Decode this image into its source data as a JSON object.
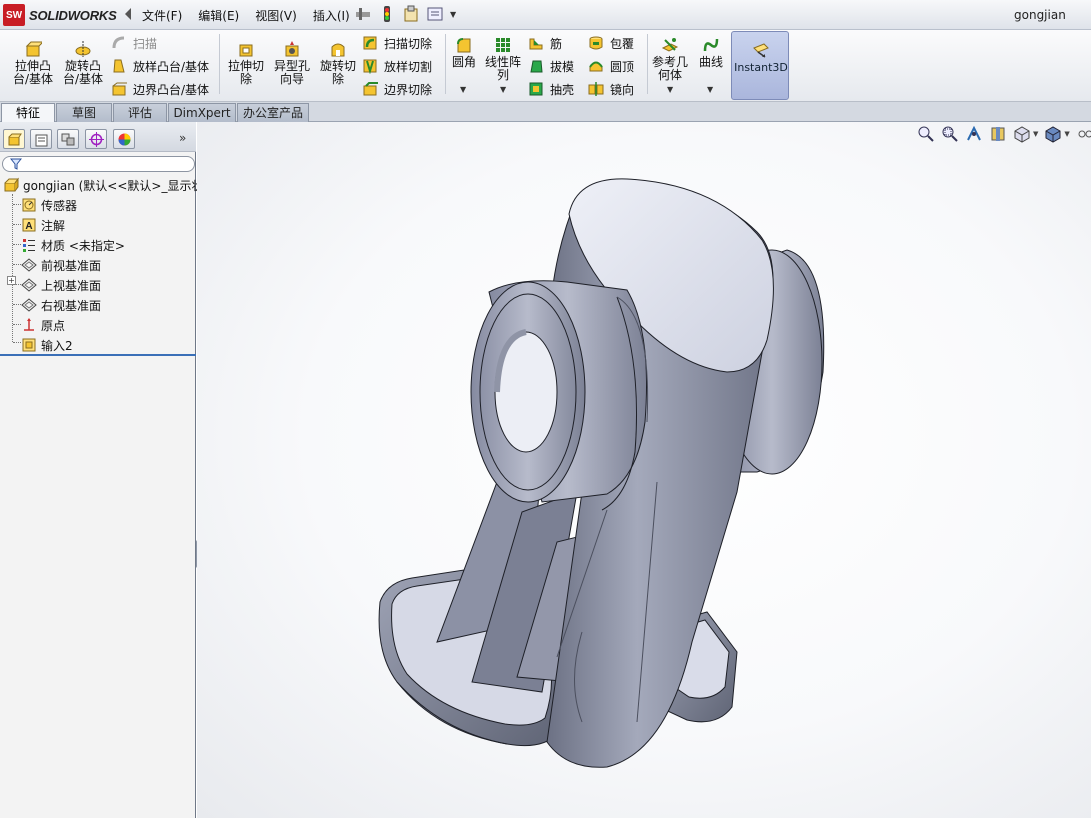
{
  "app": {
    "logo_badge": "SW",
    "logo_text": "SOLIDWORKS",
    "user": "gongjian"
  },
  "menu": {
    "items": [
      "文件(F)",
      "编辑(E)",
      "视图(V)",
      "插入(I)"
    ]
  },
  "toolbar": {
    "extrude_boss": "拉伸凸\n台/基体",
    "revolve_boss": "旋转凸\n台/基体",
    "sweep": "扫描",
    "loft_boss": "放样凸台/基体",
    "boundary_boss": "边界凸台/基体",
    "extrude_cut": "拉伸切\n除",
    "hole_wizard": "异型孔\n向导",
    "revolve_cut": "旋转切\n除",
    "swept_cut": "扫描切除",
    "lofted_cut": "放样切割",
    "boundary_cut": "边界切除",
    "fillet": "圆角",
    "linear_pattern": "线性阵\n列",
    "rib": "筋",
    "draft": "拔模",
    "shell": "抽壳",
    "wrap": "包覆",
    "dome": "圆顶",
    "mirror": "镜向",
    "ref_geometry": "参考几\n何体",
    "curves": "曲线",
    "instant3d": "Instant3D"
  },
  "tabs": [
    "特征",
    "草图",
    "评估",
    "DimXpert",
    "办公室产品"
  ],
  "active_tab": 0,
  "tree": {
    "root": "gongjian (默认<<默认>_显示状",
    "items": [
      {
        "label": "传感器",
        "icon": "sensor-icon"
      },
      {
        "label": "注解",
        "icon": "annotation-icon"
      },
      {
        "label": "材质 <未指定>",
        "icon": "material-icon"
      },
      {
        "label": "前视基准面",
        "icon": "plane-icon"
      },
      {
        "label": "上视基准面",
        "icon": "plane-icon"
      },
      {
        "label": "右视基准面",
        "icon": "plane-icon"
      },
      {
        "label": "原点",
        "icon": "origin-icon"
      },
      {
        "label": "输入2",
        "icon": "imported-body-icon"
      }
    ]
  },
  "colors": {
    "accent": "#3a6fb7",
    "part_body": "#8e94a8",
    "part_highlight": "#dfe2ee",
    "part_shadow": "#5a5f70"
  }
}
